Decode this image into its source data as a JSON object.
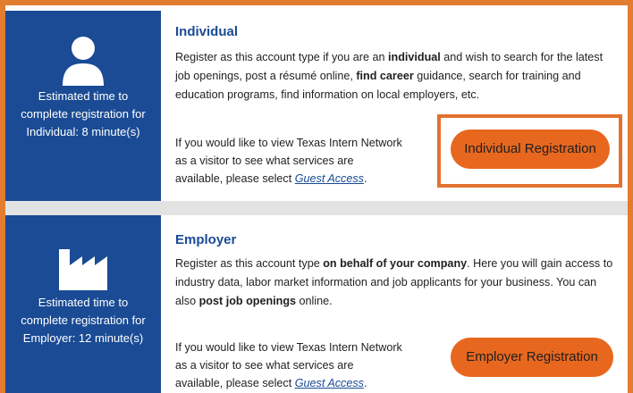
{
  "individual": {
    "title": "Individual",
    "estimate": "Estimated time to complete registration for Individual: 8 minute(s)",
    "desc_1": "Register as this account type if you are an ",
    "desc_b1": "individual",
    "desc_2": " and wish to search for the latest job openings, post a résumé online, ",
    "desc_b2": "find career",
    "desc_3": " guidance, search for training and education programs, find information on local employers, etc.",
    "visitor_text": "If you would like to view Texas Intern Network as a visitor to see what services are available, please select ",
    "guest_link": "Guest Access",
    "visitor_end": ".",
    "button_label": "Individual Registration",
    "icon": "person-icon"
  },
  "employer": {
    "title": "Employer",
    "estimate": "Estimated time to complete registration for Employer: 12 minute(s)",
    "desc_1": "Register as this account type ",
    "desc_b1": "on behalf of your company",
    "desc_2": ". Here you will gain access to industry data, labor market information and job applicants for your business. You can also ",
    "desc_b2": "post job openings",
    "desc_3": " online.",
    "visitor_text": "If you would like to view Texas Intern Network as a visitor to see what services are available, please select ",
    "guest_link": "Guest Access",
    "visitor_end": ".",
    "button_label": "Employer Registration",
    "icon": "factory-icon"
  },
  "colors": {
    "frame": "#e27c2e",
    "sidebar": "#1a4b94",
    "button": "#e7671f",
    "divider": "#e3e3e3"
  }
}
